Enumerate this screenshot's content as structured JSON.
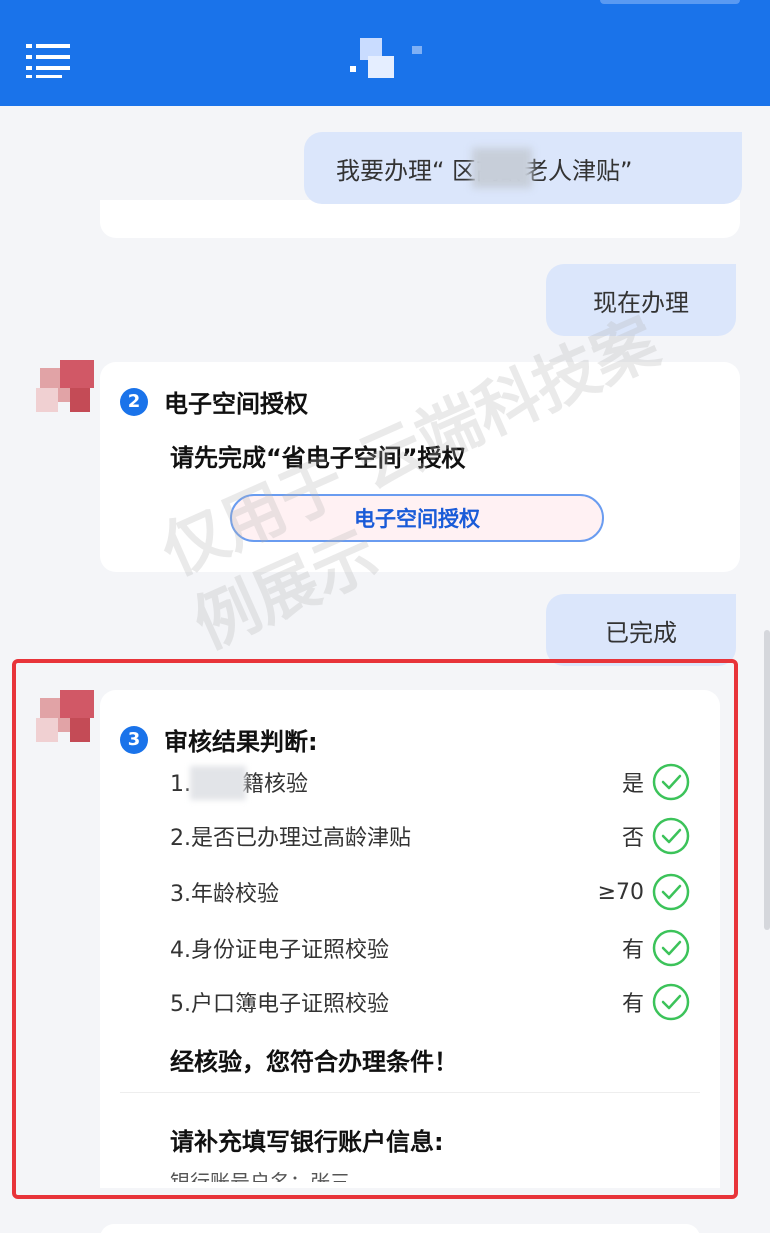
{
  "header": {
    "logo_icon": "app-logo",
    "menu_icon": "menu-icon",
    "color": "#1a73ea"
  },
  "messages": {
    "user_request": "我要办理“ 区高龄老人津贴”",
    "user_proceed": "现在办理",
    "user_done": "已完成"
  },
  "step2": {
    "number": "2",
    "title": "电子空间授权",
    "prompt": "请先完成“省电子空间”授权",
    "button_label": "电子空间授权"
  },
  "step3": {
    "number": "3",
    "title": "审核结果判断:",
    "checks": [
      {
        "label": "1. 区户籍核验",
        "value": "是",
        "status": "passed"
      },
      {
        "label": "2.是否已办理过高龄津贴",
        "value": "否",
        "status": "passed"
      },
      {
        "label": "3.年龄校验",
        "value": "≥70",
        "status": "passed"
      },
      {
        "label": "4.身份证电子证照校验",
        "value": "有",
        "status": "passed"
      },
      {
        "label": "5.户口簿电子证照校验",
        "value": "有",
        "status": "passed"
      }
    ],
    "conclusion": "经核验，您符合办理条件！",
    "fill_prompt": "请补充填写银行账户信息:",
    "account_partial": "银行账号户名：张三"
  },
  "watermark": "仅用于 云端科技案例展示",
  "colors": {
    "accent": "#1a73ea",
    "check": "#3cc35a",
    "highlight": "#e8343a"
  }
}
